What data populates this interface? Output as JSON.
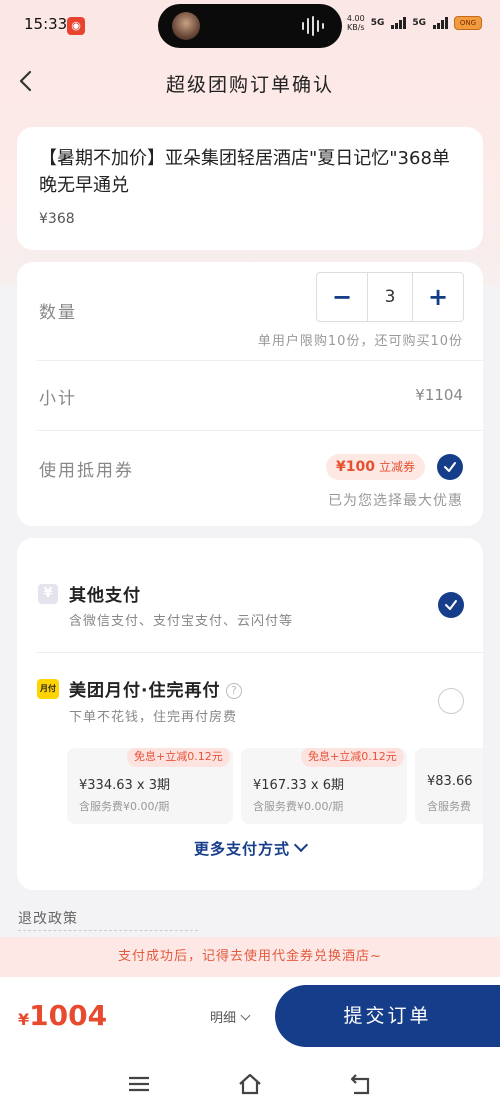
{
  "status_bar": {
    "time": "15:33",
    "net_speed_value": "4.00",
    "net_speed_unit": "KB/s",
    "signal1": "5G",
    "signal2": "5G",
    "battery": "ONG"
  },
  "nav": {
    "title": "超级团购订单确认"
  },
  "product": {
    "title": "【暑期不加价】亚朵集团轻居酒店\"夏日记忆\"368单晚无早通兑",
    "price": "¥368"
  },
  "quantity": {
    "label": "数量",
    "minus": "−",
    "value": "3",
    "plus": "+",
    "limit_note": "单用户限购10份，还可购买10份"
  },
  "subtotal": {
    "label": "小计",
    "value": "¥1104"
  },
  "coupon": {
    "label": "使用抵用券",
    "tag_amount": "¥100",
    "tag_text": "立减券",
    "note": "已为您选择最大优惠",
    "selected": true
  },
  "payment": {
    "methods": [
      {
        "icon": "other-pay-icon",
        "icon_text": "¥",
        "title": "其他支付",
        "desc": "含微信支付、支付宝支付、云闪付等",
        "selected": true
      },
      {
        "icon": "monthly-pay-icon",
        "icon_text": "月付",
        "title": "美团月付·住完再付",
        "desc": "下单不花钱，住完再付房费",
        "selected": false
      }
    ],
    "plans": [
      {
        "badge": "免息+立减0.12元",
        "main": "¥334.63 x 3期",
        "sub": "含服务费¥0.00/期"
      },
      {
        "badge": "免息+立减0.12元",
        "main": "¥167.33 x 6期",
        "sub": "含服务费¥0.00/期"
      },
      {
        "badge": "",
        "main": "¥83.66",
        "sub": "含服务费"
      }
    ],
    "more": "更多支付方式"
  },
  "policy": {
    "title": "退改政策"
  },
  "success_tip": "支付成功后，记得去使用代金券兑换酒店~",
  "bottom": {
    "currency": "¥",
    "total": "1004",
    "detail": "明细",
    "submit": "提交订单"
  },
  "colors": {
    "brand": "#163d8a",
    "accent": "#e84a2f"
  }
}
